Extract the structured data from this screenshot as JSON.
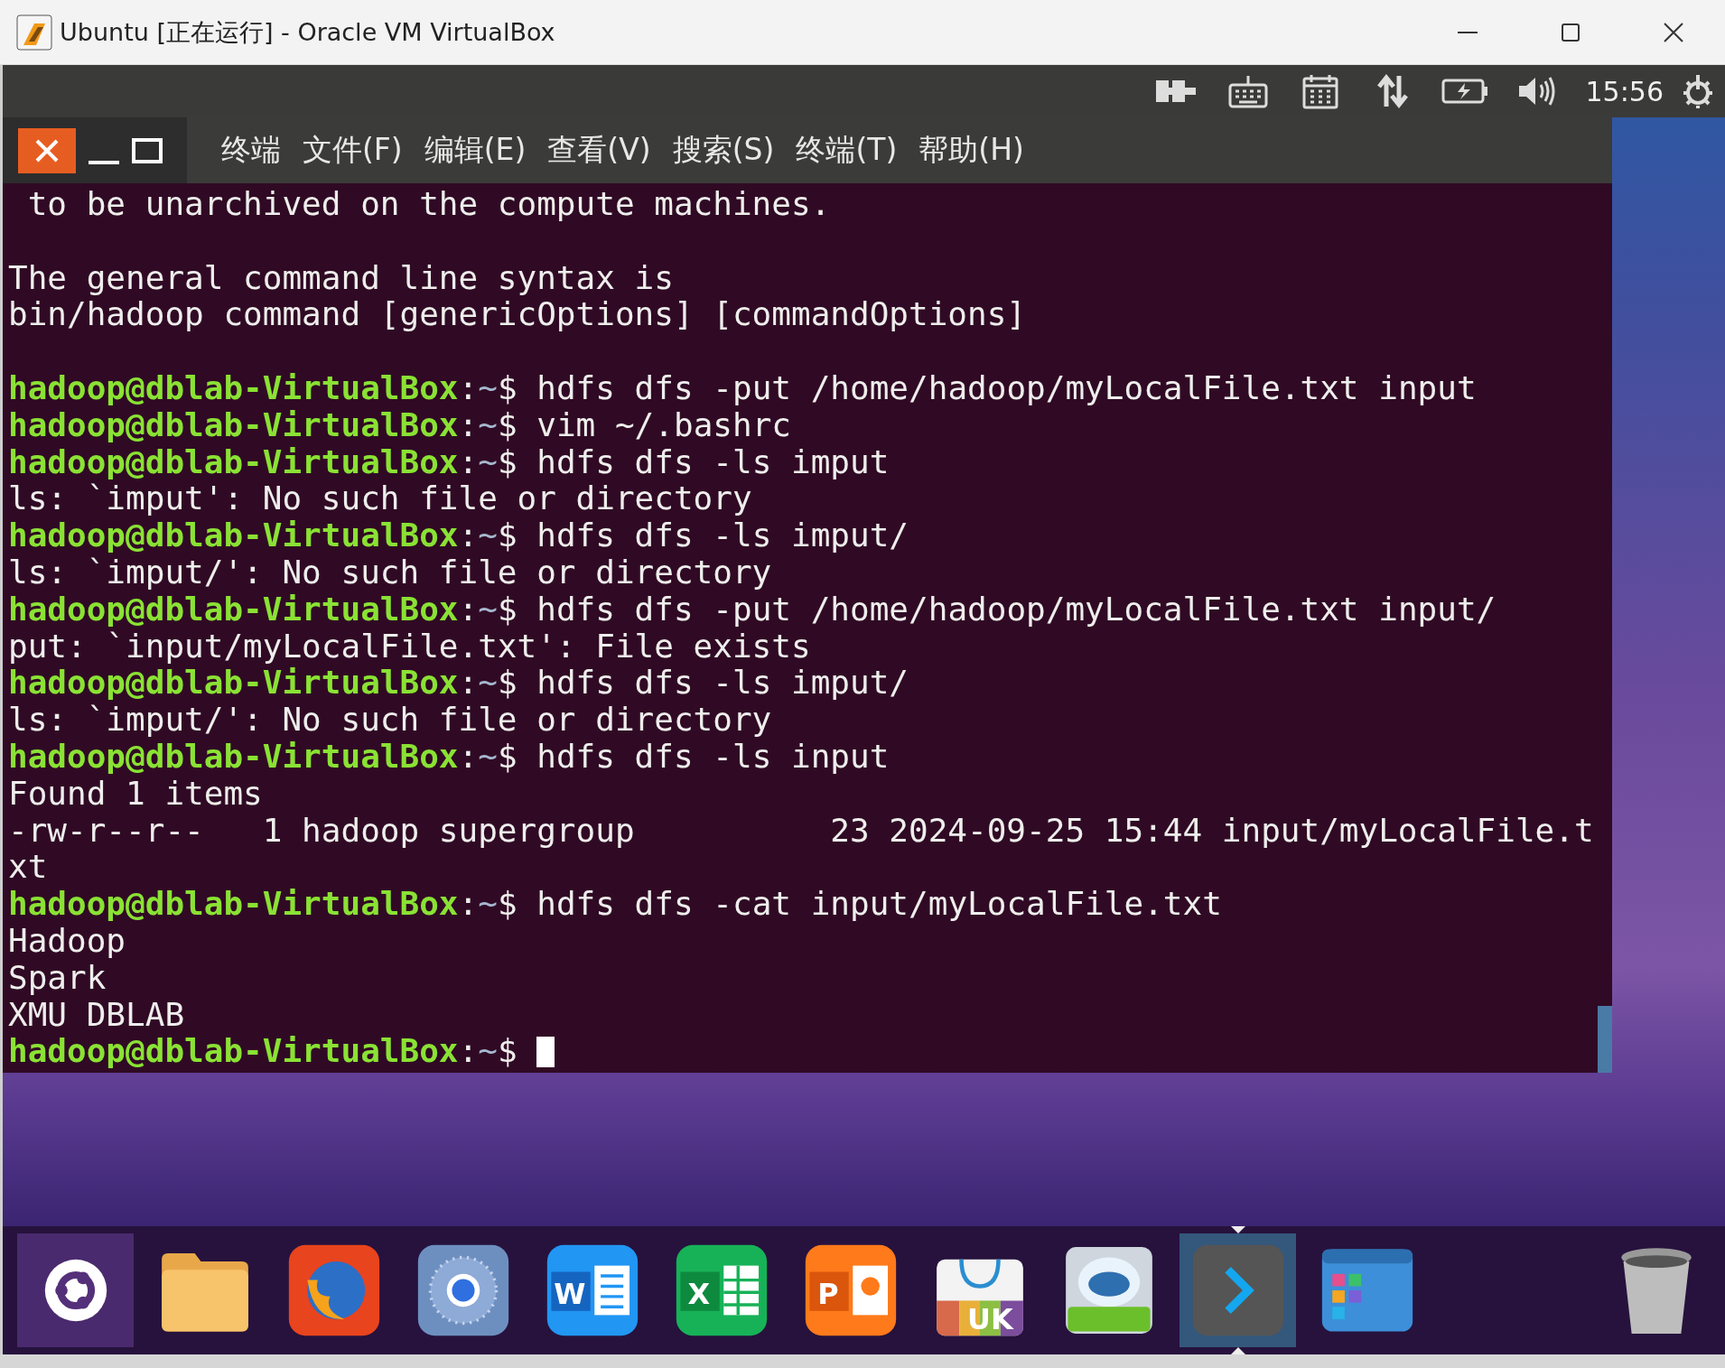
{
  "window": {
    "title": "Ubuntu [正在运行] - Oracle VM VirtualBox"
  },
  "top_panel": {
    "time": "15:56"
  },
  "terminal": {
    "menu": [
      "终端",
      "文件(F)",
      "编辑(E)",
      "查看(V)",
      "搜索(S)",
      "终端(T)",
      "帮助(H)"
    ],
    "lines": [
      {
        "kind": "output",
        "text": " to be unarchived on the compute machines."
      },
      {
        "kind": "blank"
      },
      {
        "kind": "output",
        "text": "The general command line syntax is"
      },
      {
        "kind": "output",
        "text": "bin/hadoop command [genericOptions] [commandOptions]"
      },
      {
        "kind": "blank"
      },
      {
        "kind": "prompt",
        "user": "hadoop@dblab-VirtualBox",
        "sep": ":",
        "path": "~",
        "symbol": "$",
        "command": " hdfs dfs -put /home/hadoop/myLocalFile.txt input",
        "cursor": false
      },
      {
        "kind": "prompt",
        "user": "hadoop@dblab-VirtualBox",
        "sep": ":",
        "path": "~",
        "symbol": "$",
        "command": " vim ~/.bashrc",
        "cursor": false
      },
      {
        "kind": "prompt",
        "user": "hadoop@dblab-VirtualBox",
        "sep": ":",
        "path": "~",
        "symbol": "$",
        "command": " hdfs dfs -ls imput",
        "cursor": false
      },
      {
        "kind": "output",
        "text": "ls: `imput': No such file or directory"
      },
      {
        "kind": "prompt",
        "user": "hadoop@dblab-VirtualBox",
        "sep": ":",
        "path": "~",
        "symbol": "$",
        "command": " hdfs dfs -ls imput/",
        "cursor": false
      },
      {
        "kind": "output",
        "text": "ls: `imput/': No such file or directory"
      },
      {
        "kind": "prompt",
        "user": "hadoop@dblab-VirtualBox",
        "sep": ":",
        "path": "~",
        "symbol": "$",
        "command": " hdfs dfs -put /home/hadoop/myLocalFile.txt input/",
        "cursor": false
      },
      {
        "kind": "output",
        "text": "put: `input/myLocalFile.txt': File exists"
      },
      {
        "kind": "prompt",
        "user": "hadoop@dblab-VirtualBox",
        "sep": ":",
        "path": "~",
        "symbol": "$",
        "command": " hdfs dfs -ls imput/",
        "cursor": false
      },
      {
        "kind": "output",
        "text": "ls: `imput/': No such file or directory"
      },
      {
        "kind": "prompt",
        "user": "hadoop@dblab-VirtualBox",
        "sep": ":",
        "path": "~",
        "symbol": "$",
        "command": " hdfs dfs -ls input",
        "cursor": false
      },
      {
        "kind": "output",
        "text": "Found 1 items"
      },
      {
        "kind": "output",
        "text": "-rw-r--r--   1 hadoop supergroup          23 2024-09-25 15:44 input/myLocalFile.t"
      },
      {
        "kind": "output",
        "text": "xt"
      },
      {
        "kind": "prompt",
        "user": "hadoop@dblab-VirtualBox",
        "sep": ":",
        "path": "~",
        "symbol": "$",
        "command": " hdfs dfs -cat input/myLocalFile.txt",
        "cursor": false
      },
      {
        "kind": "output",
        "text": "Hadoop"
      },
      {
        "kind": "output",
        "text": "Spark"
      },
      {
        "kind": "output",
        "text": "XMU DBLAB"
      },
      {
        "kind": "prompt",
        "user": "hadoop@dblab-VirtualBox",
        "sep": ":",
        "path": "~",
        "symbol": "$",
        "cursor": true
      }
    ]
  },
  "dock": {
    "items": [
      {
        "kind": "launcher",
        "selected": false
      },
      {
        "kind": "folder",
        "selected": false
      },
      {
        "kind": "fox",
        "selected": false
      },
      {
        "kind": "globe",
        "selected": false
      },
      {
        "kind": "doc",
        "label": "W",
        "selected": false
      },
      {
        "kind": "sheet",
        "label": "X",
        "selected": false
      },
      {
        "kind": "slides",
        "label": "P",
        "selected": false
      },
      {
        "kind": "bag",
        "label": "UK",
        "selected": false
      },
      {
        "kind": "tray",
        "selected": false
      },
      {
        "kind": "terminal",
        "selected": true
      },
      {
        "kind": "workspaces",
        "selected": false
      },
      {
        "kind": "trash",
        "selected": false
      }
    ]
  }
}
